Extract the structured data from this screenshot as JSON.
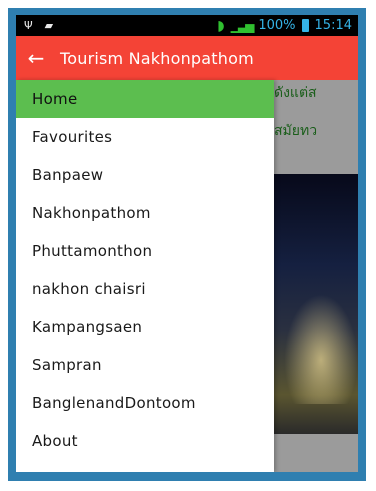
{
  "status_bar": {
    "battery": "100%",
    "time": "15:14"
  },
  "toolbar": {
    "title": "Tourism Nakhonpathom"
  },
  "content": {
    "line1": "ดังแต่ส",
    "line2": "สมัยทว"
  },
  "drawer": {
    "items": [
      {
        "label": "Home",
        "selected": true
      },
      {
        "label": "Favourites"
      },
      {
        "label": "Banpaew"
      },
      {
        "label": "Nakhonpathom"
      },
      {
        "label": "Phuttamonthon"
      },
      {
        "label": "nakhon chaisri"
      },
      {
        "label": "Kampangsaen"
      },
      {
        "label": "Sampran"
      },
      {
        "label": "BanglenandDontoom"
      },
      {
        "label": "About"
      }
    ]
  },
  "colors": {
    "toolbar": "#f44336",
    "selected_item": "#5cbe4f",
    "frame": "#2f7fb0",
    "status_accent": "#35b4e8"
  }
}
